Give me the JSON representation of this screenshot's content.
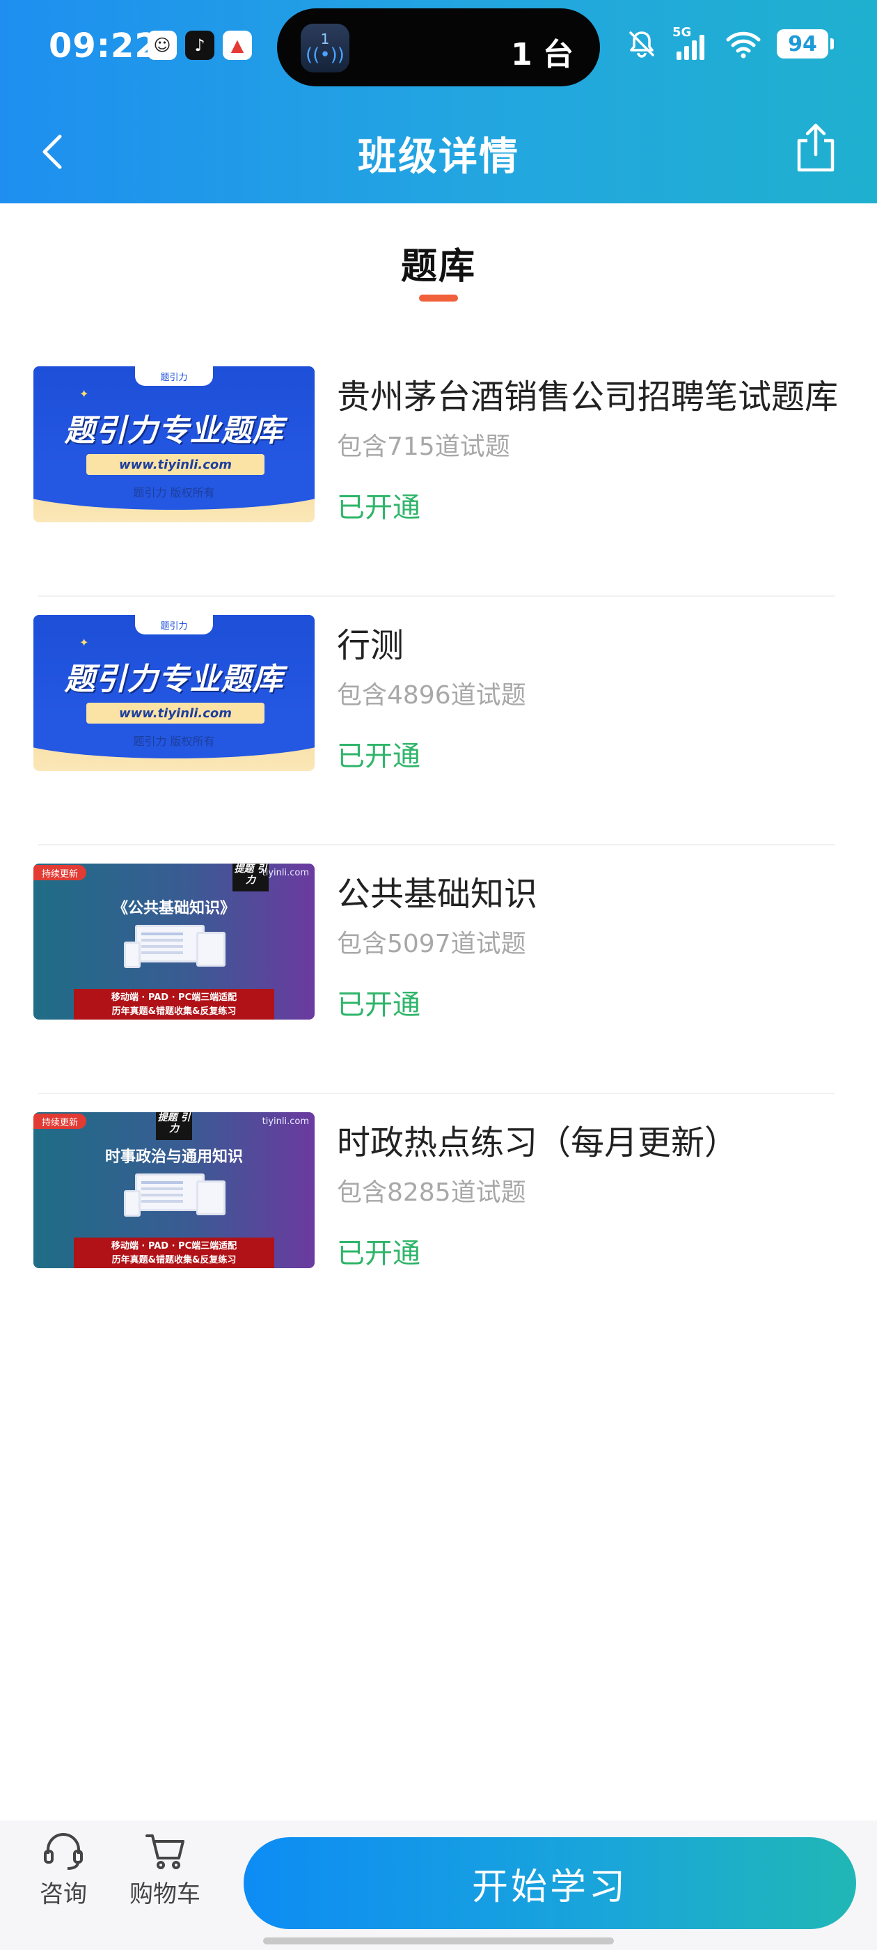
{
  "status_bar": {
    "time": "09:22",
    "island_badge": "1",
    "island_text": "1 台",
    "network": "5G",
    "battery": "94"
  },
  "nav": {
    "title": "班级详情"
  },
  "section": {
    "title": "题库",
    "accent_color": "#f0603a"
  },
  "thumbnails": {
    "a": {
      "tab_label": "题引力",
      "headline": "题引力专业题库",
      "url": "www.tiyinli.com",
      "copyright": "题引力 版权所有"
    },
    "b": {
      "badge": "持续更新",
      "site": "tiyinli.com",
      "logo": "提题 引力",
      "headline_3": "《公共基础知识》",
      "headline_4": "时事政治与通用知识",
      "banner_line1": "移动端 · PAD · PC端三端适配",
      "banner_line2": "历年真题&错题收集&反复练习"
    }
  },
  "items": [
    {
      "title": "贵州茅台酒销售公司招聘笔试题库",
      "count": "包含715道试题",
      "status": "已开通"
    },
    {
      "title": "行测",
      "count": "包含4896道试题",
      "status": "已开通"
    },
    {
      "title": "公共基础知识",
      "count": "包含5097道试题",
      "status": "已开通"
    },
    {
      "title": "时政热点练习（每月更新）",
      "count": "包含8285道试题",
      "status": "已开通"
    }
  ],
  "bottom": {
    "consult_label": "咨询",
    "cart_label": "购物车",
    "start_label": "开始学习"
  },
  "colors": {
    "header_gradient_start": "#1e8ff0",
    "header_gradient_end": "#1fb0cf",
    "status_green": "#2fb56a",
    "button_gradient_start": "#0d8cf5",
    "button_gradient_end": "#20b7b6"
  },
  "icons": [
    "back-arrow-icon",
    "share-icon",
    "headset-icon",
    "cart-icon",
    "mute-icon",
    "wifi-icon",
    "signal-icon",
    "battery-icon"
  ]
}
